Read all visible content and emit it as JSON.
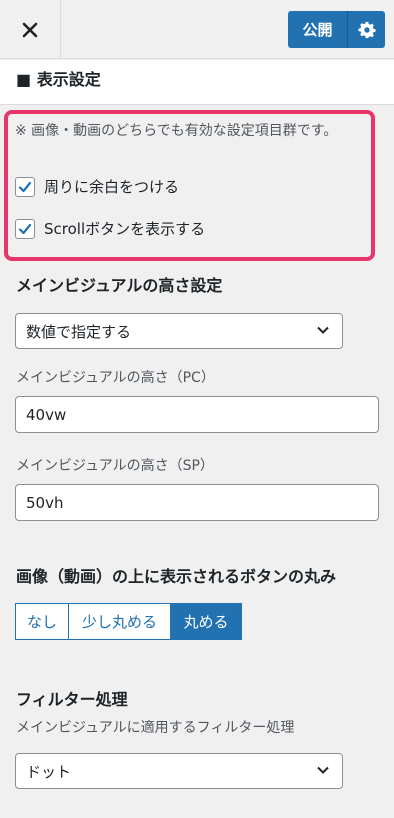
{
  "topbar": {
    "close_icon": "close-icon",
    "publish_label": "公開",
    "gear_icon": "gear-icon"
  },
  "section": {
    "title": "■ 表示設定"
  },
  "note": "※ 画像・動画のどちらでも有効な設定項目群です。",
  "checkboxes": [
    {
      "label": "周りに余白をつける",
      "checked": true
    },
    {
      "label": "Scrollボタンを表示する",
      "checked": true
    }
  ],
  "height_settings": {
    "heading": "メインビジュアルの高さ設定",
    "mode_select": "数値で指定する",
    "pc_label": "メインビジュアルの高さ（PC）",
    "pc_value": "40vw",
    "sp_label": "メインビジュアルの高さ（SP）",
    "sp_value": "50vh"
  },
  "button_radius": {
    "heading": "画像（動画）の上に表示されるボタンの丸み",
    "options": [
      "なし",
      "少し丸める",
      "丸める"
    ],
    "selected": "丸める"
  },
  "filter": {
    "heading": "フィルター処理",
    "label": "メインビジュアルに適用するフィルター処理",
    "value": "ドット"
  },
  "colors": {
    "accent": "#2271b1",
    "highlight_border": "#e8356a"
  }
}
